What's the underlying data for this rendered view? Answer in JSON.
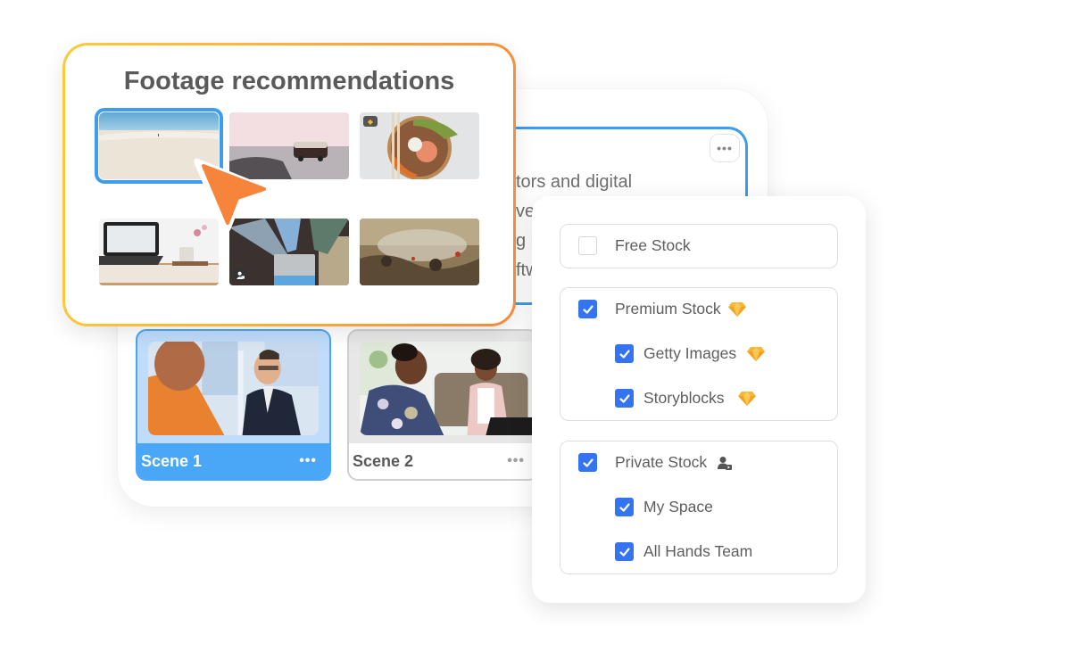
{
  "editor": {
    "script_lines": [
      "tors and digital",
      "ver",
      "g l",
      "ftw"
    ],
    "more_label": "•••"
  },
  "scenes": [
    {
      "label": "Scene 1",
      "more": "•••",
      "selected": true,
      "thumb": "two men talking in office"
    },
    {
      "label": "Scene 2",
      "more": "•••",
      "selected": false,
      "thumb": "two women on sofa"
    }
  ],
  "footage": {
    "title": "Footage recommendations",
    "tiles": [
      {
        "name": "beach-sand",
        "selected": true,
        "badge": null
      },
      {
        "name": "van-on-shore",
        "selected": false,
        "badge": null
      },
      {
        "name": "poke-bowl",
        "selected": false,
        "badge": "premium-gem-icon"
      },
      {
        "name": "laptop-desk",
        "selected": false,
        "badge": null
      },
      {
        "name": "team-laptop",
        "selected": false,
        "badge": "private-user-icon"
      },
      {
        "name": "battle-painting",
        "selected": false,
        "badge": null
      }
    ]
  },
  "filters": {
    "groups": [
      {
        "items": [
          {
            "label": "Free Stock",
            "checked": false,
            "icon": null
          }
        ]
      },
      {
        "items": [
          {
            "label": "Premium Stock",
            "checked": true,
            "icon": "gem-icon"
          },
          {
            "label": "Getty Images",
            "checked": true,
            "icon": "gem-icon"
          },
          {
            "label": "Storyblocks",
            "checked": true,
            "icon": "gem-icon"
          }
        ]
      },
      {
        "items": [
          {
            "label": "Private Stock",
            "checked": true,
            "icon": "private-user-icon"
          },
          {
            "label": "My Space",
            "checked": true,
            "icon": null
          },
          {
            "label": "All Hands Team",
            "checked": true,
            "icon": null
          }
        ]
      }
    ]
  },
  "colors": {
    "accent_blue": "#3d9bf0",
    "checkbox_blue": "#3574f0",
    "gradient_start": "#fbcb3b",
    "gradient_end": "#f7893a",
    "cursor_orange": "#f7843b",
    "gem_gold": "#f6b733"
  }
}
